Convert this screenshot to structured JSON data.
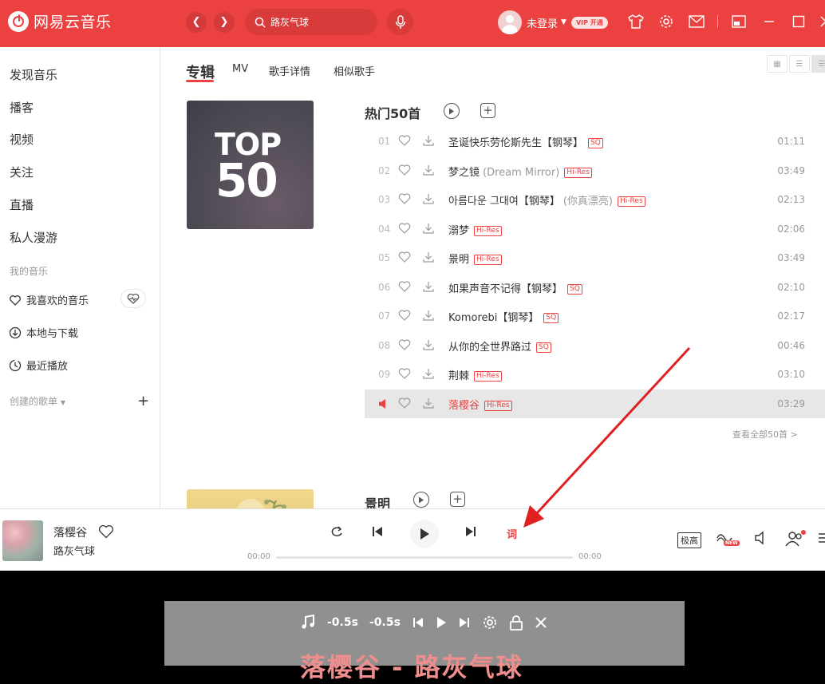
{
  "app": {
    "name": "网易云音乐",
    "search_value": "路灰气球",
    "username": "未登录",
    "vip_label": "VIP 开通"
  },
  "sidebar": {
    "items": [
      "发现音乐",
      "播客",
      "视频",
      "关注",
      "直播",
      "私人漫游"
    ],
    "my_music_header": "我的音乐",
    "my_music": [
      "我喜欢的音乐",
      "本地与下载",
      "最近播放"
    ],
    "created_playlists": "创建的歌单"
  },
  "tabs": [
    "专辑",
    "MV",
    "歌手详情",
    "相似歌手"
  ],
  "top50": {
    "cover_line1": "TOP",
    "cover_line2": "50",
    "title": "热门50首",
    "see_all": "查看全部50首 >",
    "songs": [
      {
        "num": "01",
        "title": "圣诞快乐劳伦斯先生【钢琴】",
        "alias": "",
        "tag": "SQ",
        "duration": "01:11"
      },
      {
        "num": "02",
        "title": "梦之镜",
        "alias": "(Dream Mirror)",
        "tag": "Hi-Res",
        "duration": "03:49"
      },
      {
        "num": "03",
        "title": "아름다운 그대여【钢琴】",
        "alias": "(你真漂亮)",
        "tag": "Hi-Res",
        "duration": "02:13"
      },
      {
        "num": "04",
        "title": "溺梦",
        "alias": "",
        "tag": "Hi-Res",
        "duration": "02:06"
      },
      {
        "num": "05",
        "title": "景明",
        "alias": "",
        "tag": "Hi-Res",
        "duration": "03:49"
      },
      {
        "num": "06",
        "title": "如果声音不记得【钢琴】",
        "alias": "",
        "tag": "SQ",
        "duration": "02:10"
      },
      {
        "num": "07",
        "title": "Komorebi【钢琴】",
        "alias": "",
        "tag": "SQ",
        "duration": "02:17"
      },
      {
        "num": "08",
        "title": "从你的全世界路过",
        "alias": "",
        "tag": "SQ",
        "duration": "00:46"
      },
      {
        "num": "09",
        "title": "荆棘",
        "alias": "",
        "tag": "Hi-Res",
        "duration": "03:10"
      },
      {
        "num": "",
        "title": "落樱谷",
        "alias": "",
        "tag": "Hi-Res",
        "duration": "03:29"
      }
    ]
  },
  "album2": {
    "title": "景明"
  },
  "player": {
    "title": "落樱谷",
    "artist": "路灰气球",
    "lyric_btn": "词",
    "time_current": "00:00",
    "time_total": "00:00",
    "progress": 0,
    "quality": "极高"
  },
  "desktop_lyric": {
    "back": "-0.5s",
    "forward": "-0.5s",
    "text": "落樱谷 - 路灰气球"
  },
  "colors": {
    "accent": "#ec4141",
    "arrow": "#e02020"
  }
}
